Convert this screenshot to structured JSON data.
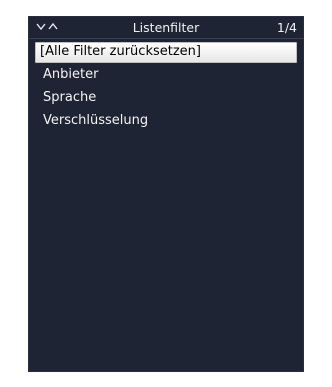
{
  "header": {
    "title": "Listenfilter",
    "page_indicator": "1/4",
    "nav_icon": "chevron-down-up-icon"
  },
  "list": {
    "items": [
      {
        "label": "[Alle Filter zurücksetzen]",
        "selected": true
      },
      {
        "label": "Anbieter",
        "selected": false
      },
      {
        "label": "Sprache",
        "selected": false
      },
      {
        "label": "Verschlüsselung",
        "selected": false
      }
    ]
  },
  "colors": {
    "background": "#1f2434",
    "highlight": "#ffffff",
    "text": "#f2f2f2"
  }
}
